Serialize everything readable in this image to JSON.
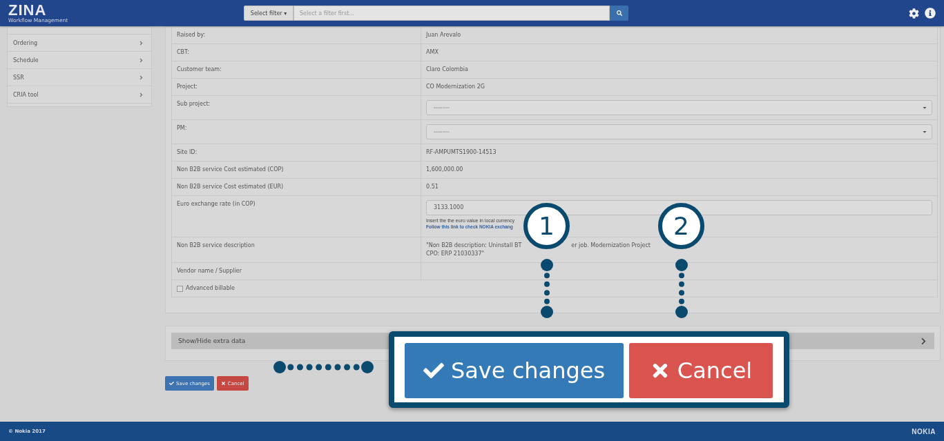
{
  "header": {
    "logo": "ZINA",
    "subtitle": "Workflow Management",
    "filter_button": "Select filter ▾",
    "search": {
      "placeholder": "Select a filter first..."
    }
  },
  "sidebar": {
    "items": [
      {
        "label": "Ordering"
      },
      {
        "label": "Schedule"
      },
      {
        "label": "SSR"
      },
      {
        "label": "CRIA tool"
      }
    ]
  },
  "details": {
    "rows": [
      {
        "kind": "text",
        "label": "Raised by:",
        "value": "Juan Arevalo"
      },
      {
        "kind": "text",
        "label": "CBT:",
        "value": "AMX"
      },
      {
        "kind": "text",
        "label": "Customer team:",
        "value": "Claro Colombia"
      },
      {
        "kind": "text",
        "label": "Project:",
        "value": "CO Modernization 2G"
      },
      {
        "kind": "select",
        "label": "Sub project:",
        "value": "---------"
      },
      {
        "kind": "select",
        "label": "PM:",
        "value": "---------"
      },
      {
        "kind": "text",
        "label": "Site ID:",
        "value": "RF-AMPUMTS1900-14513"
      },
      {
        "kind": "text",
        "label": "Non B2B service Cost estimated (COP)",
        "value": "1,600,000.00"
      },
      {
        "kind": "text",
        "label": "Non B2B service Cost estimated (EUR)",
        "value": "0.51"
      },
      {
        "kind": "input",
        "label": "Euro exchange rate (in COP)",
        "value": "3133.1000",
        "help": "Insert the the euro value in local currency",
        "link": "Follow this link to check NOKIA exchang"
      },
      {
        "kind": "description",
        "label": "Non B2B service description",
        "parts": [
          "\"Non B2B description: Uninstall BT",
          "er job. Modernization Project"
        ],
        "line2": "CPO: ERP 21030337\""
      },
      {
        "kind": "text",
        "label": "Vendor name / Supplier",
        "value": ""
      },
      {
        "kind": "checkbox",
        "label": "Advanced billable",
        "checked": false
      }
    ]
  },
  "extra": {
    "label": "Show/Hide extra data",
    "expanded": false
  },
  "actions": {
    "save": "Save changes",
    "cancel": "Cancel"
  },
  "callout": {
    "save": "Save changes",
    "cancel": "Cancel",
    "steps": [
      "1",
      "2"
    ]
  },
  "footer": {
    "copyright": "© Nokia 2017",
    "brand": "NOKIA"
  }
}
